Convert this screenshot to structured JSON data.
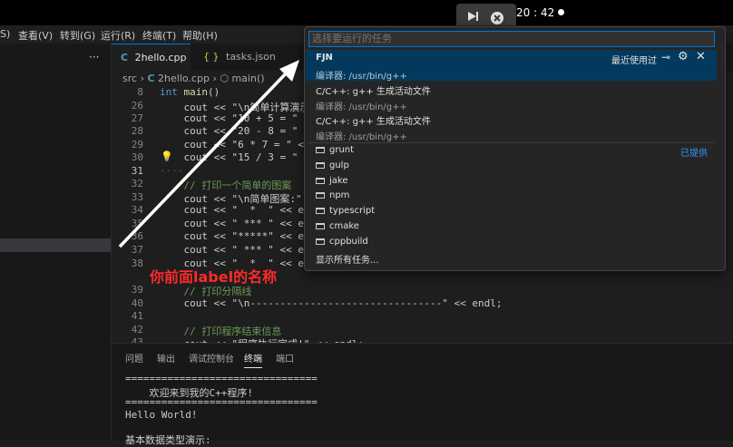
{
  "topbar": {
    "clock": "20 : 42"
  },
  "menubar": {
    "items": [
      "S)",
      "查看(V)",
      "转到(G)",
      "运行(R)",
      "终端(T)",
      "帮助(H)"
    ]
  },
  "sidebar": {
    "more": "···"
  },
  "tabs": [
    {
      "label": "2hello.cpp"
    },
    {
      "label": "tasks.json"
    }
  ],
  "breadcrumb": {
    "folder": "src",
    "file": "2hello.cpp",
    "symbol": "main()"
  },
  "editor": {
    "lines": [
      {
        "n": "8",
        "text": "int main()"
      },
      {
        "n": "26",
        "text": "    cout << \"\\n简单计算演示"
      },
      {
        "n": "27",
        "text": "    cout << \"10 + 5 = \" <"
      },
      {
        "n": "28",
        "text": "    cout << \"20 - 8 = \" <"
      },
      {
        "n": "29",
        "text": "    cout << \"6 * 7 = \" <<"
      },
      {
        "n": "30",
        "text": "    cout << \"15 / 3 = \" <"
      },
      {
        "n": "31",
        "text": "····"
      },
      {
        "n": "32",
        "text": "    // 打印一个简单的图案"
      },
      {
        "n": "33",
        "text": "    cout << \"\\n简单图案:\""
      },
      {
        "n": "34",
        "text": "    cout << \"  *  \" << en"
      },
      {
        "n": "35",
        "text": "    cout << \" *** \" << en"
      },
      {
        "n": "36",
        "text": "    cout << \"*****\" << en"
      },
      {
        "n": "37",
        "text": "    cout << \" *** \" << en"
      },
      {
        "n": "38",
        "text": "    cout << \"  *  \" << en"
      },
      {
        "n": "39",
        "text": "    // 打印分隔线"
      },
      {
        "n": "40",
        "text": "    cout << \"\\n--------------------------------\" << endl;"
      },
      {
        "n": "41",
        "text": ""
      },
      {
        "n": "42",
        "text": "    // 打印程序结束信息"
      },
      {
        "n": "43",
        "text": "    cout << \"程序执行完成!\" << endl;"
      }
    ]
  },
  "panel": {
    "tabs": [
      "问题",
      "输出",
      "调试控制台",
      "终端",
      "端口"
    ],
    "terminal": [
      "================================",
      "    欢迎来到我的C++程序!",
      "================================",
      "Hello World!",
      "",
      "基本数据类型演示:"
    ]
  },
  "quickpick": {
    "placeholder": "选择要运行的任务",
    "recently_used": "最近使用过",
    "provided": "已提供",
    "tasks": [
      {
        "label": "FJN",
        "detail": "编译器: /usr/bin/g++"
      },
      {
        "label": "C/C++: g++ 生成活动文件",
        "detail": "编译器: /usr/bin/g++"
      },
      {
        "label": "C/C++: g++ 生成活动文件",
        "detail": "编译器: /usr/bin/g++"
      }
    ],
    "providers": [
      "grunt",
      "gulp",
      "jake",
      "npm",
      "typescript",
      "cmake",
      "cppbuild"
    ],
    "show_all": "显示所有任务..."
  },
  "annotation": {
    "text": "你前面label的名称",
    "color": "#ff2a2a"
  },
  "colors": {
    "accent": "#0078d4",
    "selection": "#04395e",
    "annotation": "#ff2a2a"
  }
}
